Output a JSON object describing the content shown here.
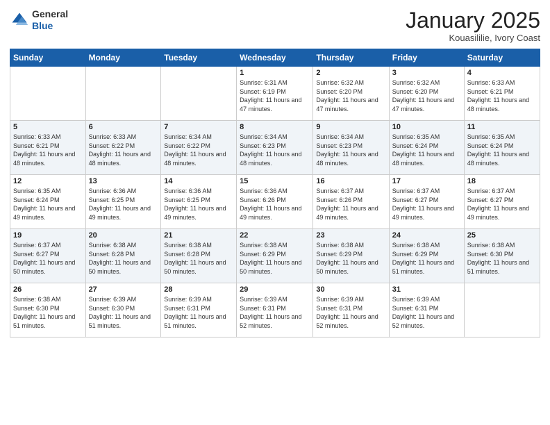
{
  "logo": {
    "general": "General",
    "blue": "Blue"
  },
  "header": {
    "month": "January 2025",
    "location": "Kouasililie, Ivory Coast"
  },
  "days_of_week": [
    "Sunday",
    "Monday",
    "Tuesday",
    "Wednesday",
    "Thursday",
    "Friday",
    "Saturday"
  ],
  "weeks": [
    [
      null,
      null,
      null,
      {
        "num": "1",
        "sunrise": "6:31 AM",
        "sunset": "6:19 PM",
        "daylight": "11 hours and 47 minutes."
      },
      {
        "num": "2",
        "sunrise": "6:32 AM",
        "sunset": "6:20 PM",
        "daylight": "11 hours and 47 minutes."
      },
      {
        "num": "3",
        "sunrise": "6:32 AM",
        "sunset": "6:20 PM",
        "daylight": "11 hours and 47 minutes."
      },
      {
        "num": "4",
        "sunrise": "6:33 AM",
        "sunset": "6:21 PM",
        "daylight": "11 hours and 48 minutes."
      }
    ],
    [
      {
        "num": "5",
        "sunrise": "6:33 AM",
        "sunset": "6:21 PM",
        "daylight": "11 hours and 48 minutes."
      },
      {
        "num": "6",
        "sunrise": "6:33 AM",
        "sunset": "6:22 PM",
        "daylight": "11 hours and 48 minutes."
      },
      {
        "num": "7",
        "sunrise": "6:34 AM",
        "sunset": "6:22 PM",
        "daylight": "11 hours and 48 minutes."
      },
      {
        "num": "8",
        "sunrise": "6:34 AM",
        "sunset": "6:23 PM",
        "daylight": "11 hours and 48 minutes."
      },
      {
        "num": "9",
        "sunrise": "6:34 AM",
        "sunset": "6:23 PM",
        "daylight": "11 hours and 48 minutes."
      },
      {
        "num": "10",
        "sunrise": "6:35 AM",
        "sunset": "6:24 PM",
        "daylight": "11 hours and 48 minutes."
      },
      {
        "num": "11",
        "sunrise": "6:35 AM",
        "sunset": "6:24 PM",
        "daylight": "11 hours and 48 minutes."
      }
    ],
    [
      {
        "num": "12",
        "sunrise": "6:35 AM",
        "sunset": "6:24 PM",
        "daylight": "11 hours and 49 minutes."
      },
      {
        "num": "13",
        "sunrise": "6:36 AM",
        "sunset": "6:25 PM",
        "daylight": "11 hours and 49 minutes."
      },
      {
        "num": "14",
        "sunrise": "6:36 AM",
        "sunset": "6:25 PM",
        "daylight": "11 hours and 49 minutes."
      },
      {
        "num": "15",
        "sunrise": "6:36 AM",
        "sunset": "6:26 PM",
        "daylight": "11 hours and 49 minutes."
      },
      {
        "num": "16",
        "sunrise": "6:37 AM",
        "sunset": "6:26 PM",
        "daylight": "11 hours and 49 minutes."
      },
      {
        "num": "17",
        "sunrise": "6:37 AM",
        "sunset": "6:27 PM",
        "daylight": "11 hours and 49 minutes."
      },
      {
        "num": "18",
        "sunrise": "6:37 AM",
        "sunset": "6:27 PM",
        "daylight": "11 hours and 49 minutes."
      }
    ],
    [
      {
        "num": "19",
        "sunrise": "6:37 AM",
        "sunset": "6:27 PM",
        "daylight": "11 hours and 50 minutes."
      },
      {
        "num": "20",
        "sunrise": "6:38 AM",
        "sunset": "6:28 PM",
        "daylight": "11 hours and 50 minutes."
      },
      {
        "num": "21",
        "sunrise": "6:38 AM",
        "sunset": "6:28 PM",
        "daylight": "11 hours and 50 minutes."
      },
      {
        "num": "22",
        "sunrise": "6:38 AM",
        "sunset": "6:29 PM",
        "daylight": "11 hours and 50 minutes."
      },
      {
        "num": "23",
        "sunrise": "6:38 AM",
        "sunset": "6:29 PM",
        "daylight": "11 hours and 50 minutes."
      },
      {
        "num": "24",
        "sunrise": "6:38 AM",
        "sunset": "6:29 PM",
        "daylight": "11 hours and 51 minutes."
      },
      {
        "num": "25",
        "sunrise": "6:38 AM",
        "sunset": "6:30 PM",
        "daylight": "11 hours and 51 minutes."
      }
    ],
    [
      {
        "num": "26",
        "sunrise": "6:38 AM",
        "sunset": "6:30 PM",
        "daylight": "11 hours and 51 minutes."
      },
      {
        "num": "27",
        "sunrise": "6:39 AM",
        "sunset": "6:30 PM",
        "daylight": "11 hours and 51 minutes."
      },
      {
        "num": "28",
        "sunrise": "6:39 AM",
        "sunset": "6:31 PM",
        "daylight": "11 hours and 51 minutes."
      },
      {
        "num": "29",
        "sunrise": "6:39 AM",
        "sunset": "6:31 PM",
        "daylight": "11 hours and 52 minutes."
      },
      {
        "num": "30",
        "sunrise": "6:39 AM",
        "sunset": "6:31 PM",
        "daylight": "11 hours and 52 minutes."
      },
      {
        "num": "31",
        "sunrise": "6:39 AM",
        "sunset": "6:31 PM",
        "daylight": "11 hours and 52 minutes."
      },
      null
    ]
  ]
}
